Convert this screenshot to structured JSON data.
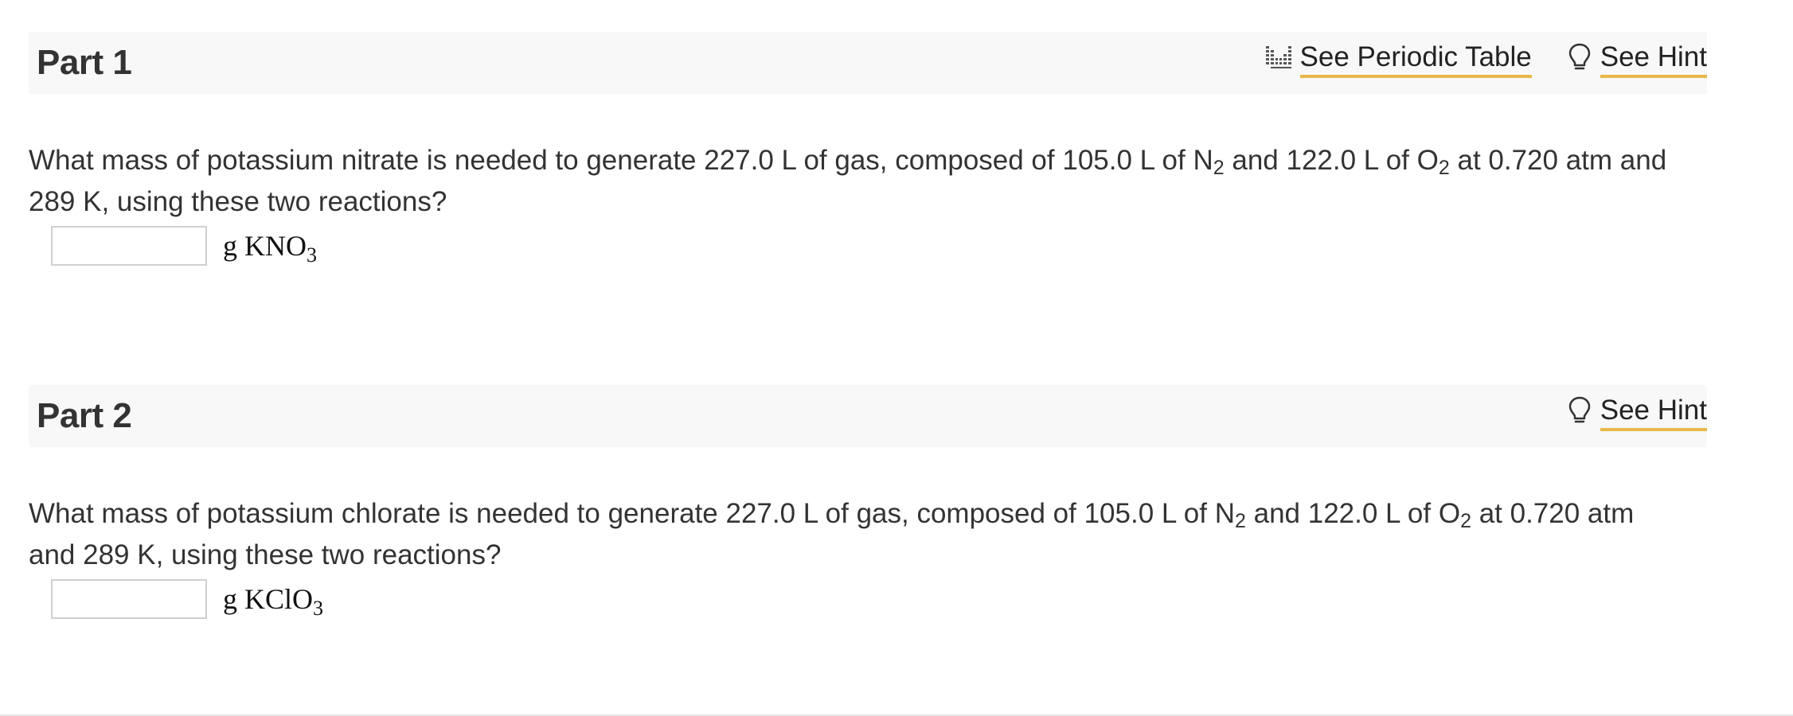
{
  "colors": {
    "header_bg": "#f8f8f8",
    "hint_underline": "#e8b84a",
    "text": "#333333"
  },
  "part1": {
    "title": "Part 1",
    "periodic_table_label": "See Periodic Table",
    "periodic_table_icon": "periodic-table-icon",
    "hint_label": "See Hint",
    "hint_icon": "lightbulb-icon",
    "question": {
      "t1": "What mass of potassium nitrate is needed to generate 227.0  L of gas, composed of 105.0  L of N",
      "s1": "2",
      "t2": " and 122.0  L of O",
      "s2": "2",
      "t3": " at 0.720 atm and 289  K, using these two reactions?"
    },
    "answer_value": "",
    "unit": {
      "prefix": "g KNO",
      "sub": "3",
      "suffix": ""
    }
  },
  "part2": {
    "title": "Part 2",
    "hint_label": "See Hint",
    "hint_icon": "lightbulb-icon",
    "question": {
      "t1": "What mass of potassium chlorate is needed to generate 227.0 L of gas, composed of 105.0 L of N",
      "s1": "2",
      "t2": " and 122.0 L of O",
      "s2": "2",
      "t3": " at 0.720 atm and 289 K, using these two reactions?"
    },
    "answer_value": "",
    "unit": {
      "prefix": "g KClO",
      "sub": "3",
      "suffix": ""
    }
  }
}
